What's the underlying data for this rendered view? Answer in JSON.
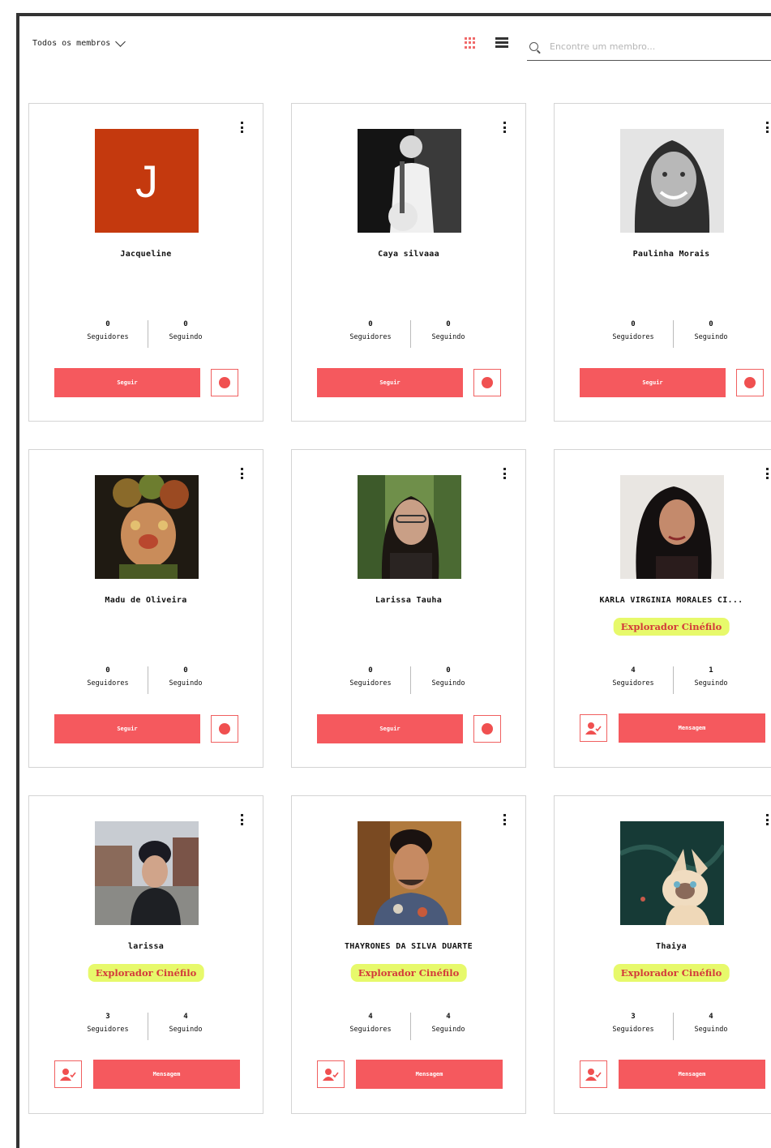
{
  "toolbar": {
    "filter_label": "Todos os membros",
    "search_placeholder": "Encontre um membro..."
  },
  "colors": {
    "accent": "#f5595e",
    "badge_bg": "#e7f96b",
    "badge_text": "#d33a3a",
    "initial_bg": "#c4390e"
  },
  "members": [
    {
      "name": "Jacqueline",
      "initial": "J",
      "followers": "0",
      "following": "0",
      "followers_label": "Seguidores",
      "following_label": "Seguindo",
      "action": "Seguir"
    },
    {
      "name": "Caya silvaaa",
      "followers": "0",
      "following": "0",
      "followers_label": "Seguidores",
      "following_label": "Seguindo",
      "action": "Seguir"
    },
    {
      "name": "Paulinha Morais",
      "followers": "0",
      "following": "0",
      "followers_label": "Seguidores",
      "following_label": "Seguindo",
      "action": "Seguir"
    },
    {
      "name": "Madu de Oliveira",
      "followers": "0",
      "following": "0",
      "followers_label": "Seguidores",
      "following_label": "Seguindo",
      "action": "Seguir"
    },
    {
      "name": "Larissa Tauha",
      "followers": "0",
      "following": "0",
      "followers_label": "Seguidores",
      "following_label": "Seguindo",
      "action": "Seguir"
    },
    {
      "name": "KARLA VIRGINIA MORALES CI...",
      "badge": "Explorador Cinéfilo",
      "followers": "4",
      "following": "1",
      "followers_label": "Seguidores",
      "following_label": "Seguindo",
      "action": "Mensagem"
    },
    {
      "name": "larissa",
      "badge": "Explorador Cinéfilo",
      "followers": "3",
      "following": "4",
      "followers_label": "Seguidores",
      "following_label": "Seguindo",
      "action": "Mensagem"
    },
    {
      "name": "THAYRONES DA SILVA DUARTE",
      "badge": "Explorador Cinéfilo",
      "followers": "4",
      "following": "4",
      "followers_label": "Seguidores",
      "following_label": "Seguindo",
      "action": "Mensagem"
    },
    {
      "name": "Thaiya",
      "badge": "Explorador Cinéfilo",
      "followers": "3",
      "following": "4",
      "followers_label": "Seguidores",
      "following_label": "Seguindo",
      "action": "Mensagem"
    }
  ]
}
